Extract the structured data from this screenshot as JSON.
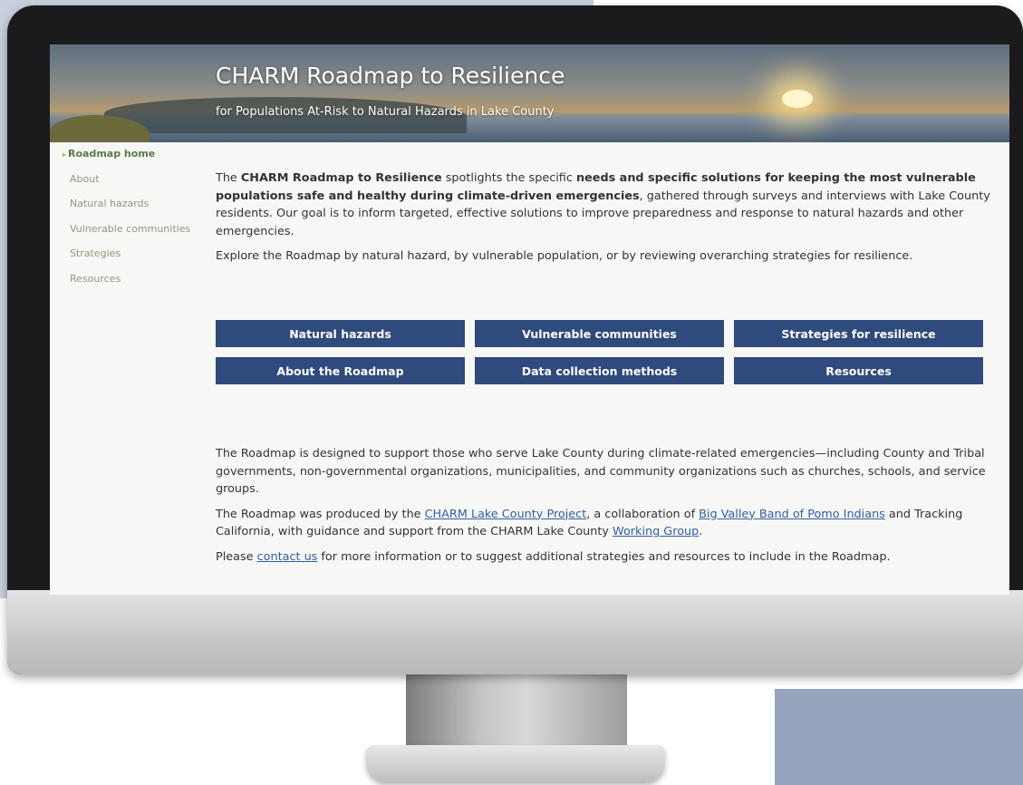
{
  "header": {
    "title": "CHARM Roadmap to Resilience",
    "subtitle": "for Populations At-Risk to Natural Hazards in Lake County"
  },
  "sidebar": {
    "items": [
      {
        "label": "Roadmap home",
        "active": true
      },
      {
        "label": "About"
      },
      {
        "label": "Natural hazards"
      },
      {
        "label": "Vulnerable communities"
      },
      {
        "label": "Strategies"
      },
      {
        "label": "Resources"
      }
    ]
  },
  "intro": {
    "t1": "The ",
    "b1": "CHARM Roadmap to Resilience",
    "t2": " spotlights the specific ",
    "b2": "needs and specific solutions for keeping the most vulnerable populations safe and healthy during climate-driven emergencies",
    "t3": ", gathered through surveys and interviews with Lake County residents. Our goal is to inform targeted, effective solutions to improve preparedness and response to natural hazards and other emergencies.",
    "explore": "Explore the Roadmap by natural hazard, by vulnerable population, or by reviewing overarching strategies for resilience."
  },
  "buttons": [
    "Natural hazards",
    "Vulnerable communities",
    "Strategies for resilience",
    "About the Roadmap",
    "Data collection methods",
    "Resources"
  ],
  "footer": {
    "p1": "The Roadmap is designed to support those who serve Lake County during climate-related emergencies—including County and Tribal governments, non-governmental organizations, municipalities, and community organizations such as churches, schools, and service groups.",
    "p2_a": "The Roadmap was produced by the ",
    "p2_link1": "CHARM Lake County Project",
    "p2_b": ", a collaboration of ",
    "p2_link2": "Big Valley Band of Pomo Indians",
    "p2_c": " and Tracking California, with guidance and support from the CHARM Lake County ",
    "p2_link3": "Working Group",
    "p2_d": ".",
    "p3_a": "Please ",
    "p3_link": "contact us",
    "p3_b": " for more information or to suggest additional strategies and resources to include in the Roadmap."
  },
  "colors": {
    "button_bg": "#2f4a7c",
    "nav_active": "#5b7a48",
    "link": "#2f5fa8"
  }
}
